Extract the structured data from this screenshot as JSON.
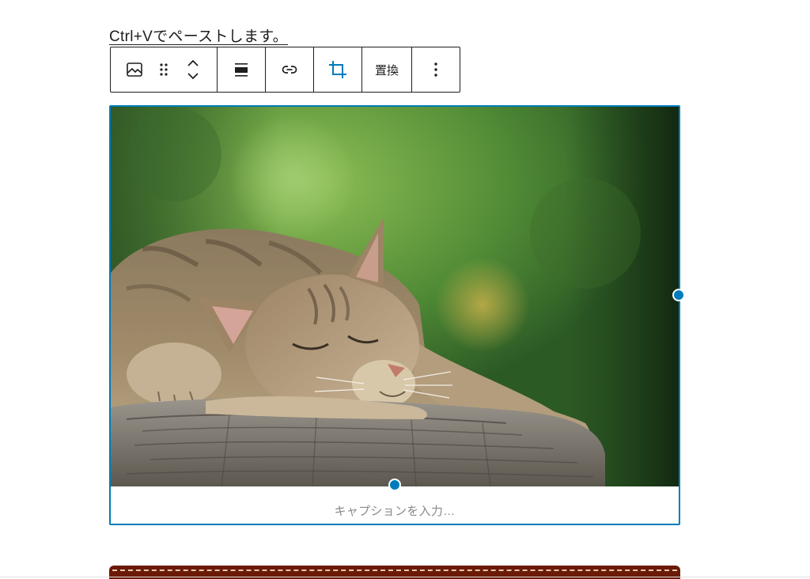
{
  "paragraph": {
    "text": "Ctrl+Vでペーストします。"
  },
  "toolbar": {
    "image_icon": "image-icon",
    "drag_icon": "drag-handle-icon",
    "move_up_icon": "chevron-up-icon",
    "move_down_icon": "chevron-down-icon",
    "align_icon": "align-none-icon",
    "link_icon": "link-icon",
    "crop_icon": "crop-icon",
    "replace_label": "置換",
    "more_icon": "more-vertical-icon"
  },
  "image_block": {
    "caption_placeholder": "キャプションを入力…"
  },
  "colors": {
    "accent": "#007cba",
    "text": "#1e1e1e",
    "caption": "#8a8a8a",
    "next_block": "#6b1a05"
  }
}
